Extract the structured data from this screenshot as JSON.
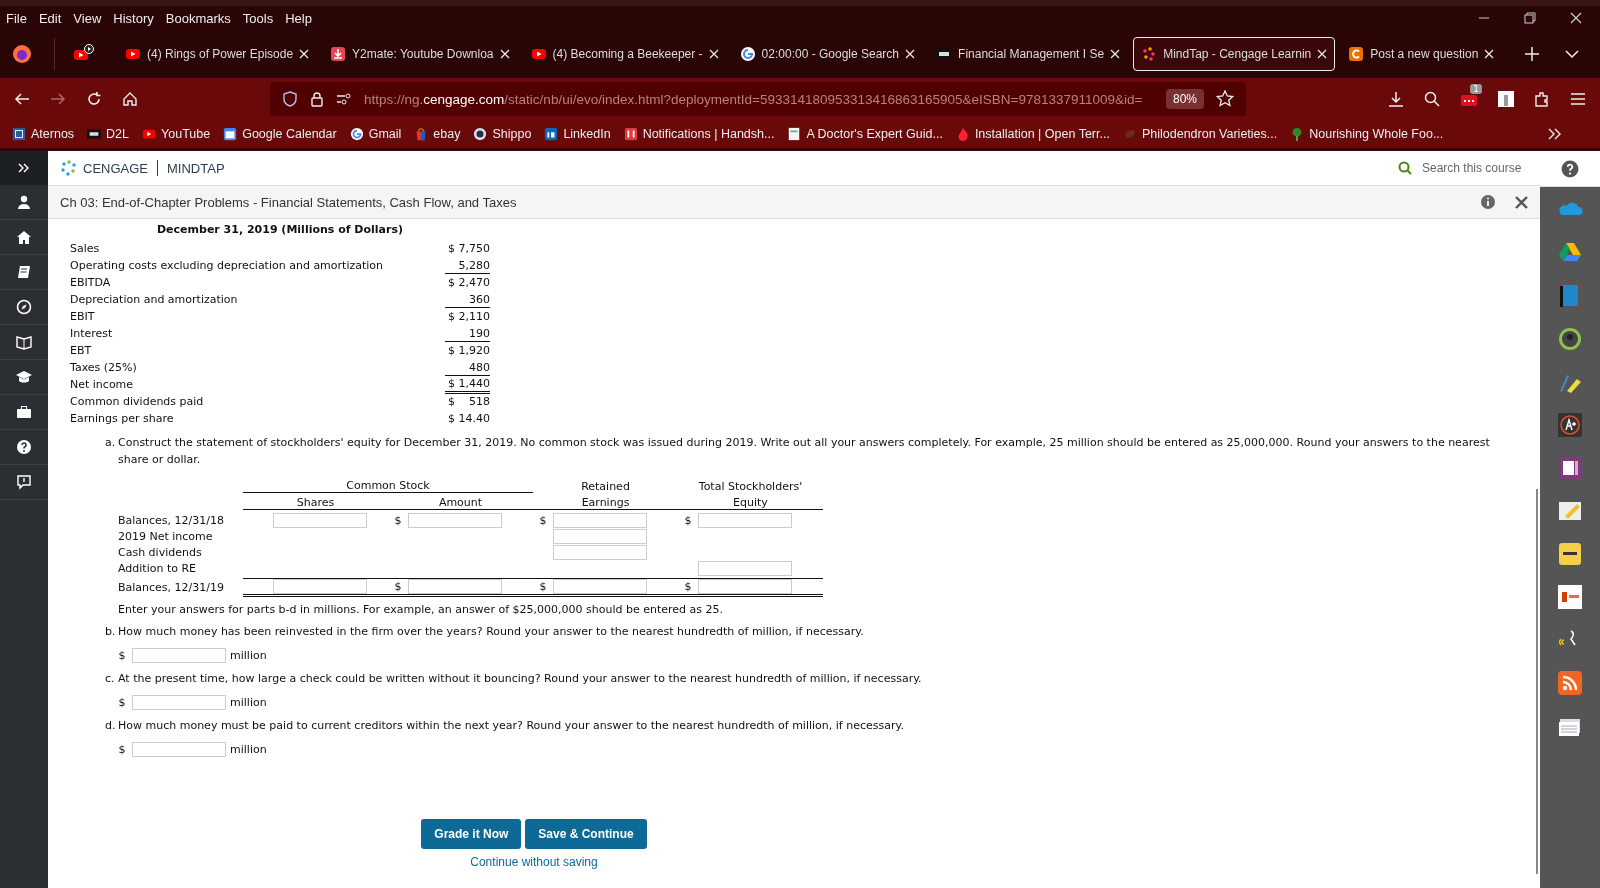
{
  "browser": {
    "menu": [
      "File",
      "Edit",
      "View",
      "History",
      "Bookmarks",
      "Tools",
      "Help"
    ],
    "tabs": [
      {
        "label": "(4) Rings of Power Episode",
        "kind": "youtube",
        "selected": false
      },
      {
        "label": "Y2mate: Youtube Downloa",
        "kind": "download",
        "selected": false
      },
      {
        "label": "(4) Becoming a Beekeeper -",
        "kind": "youtube",
        "selected": false
      },
      {
        "label": "02:00:00 - Google Search",
        "kind": "google",
        "selected": false
      },
      {
        "label": "Financial Management I Se",
        "kind": "d2l",
        "selected": false
      },
      {
        "label": "MindTap - Cengage Learnin",
        "kind": "mindtap",
        "selected": true
      },
      {
        "label": "Post a new question",
        "kind": "chegg",
        "selected": false
      }
    ],
    "url": {
      "prefix": "https://ng.",
      "host": "cengage.com",
      "rest": "/static/nb/ui/evo/index.html?deploymentId=593314180953313416863165905&eISBN=9781337911009&id="
    },
    "zoom": "80%",
    "extension_badge": "1",
    "bookmarks": [
      {
        "label": "Aternos",
        "kind": "grid"
      },
      {
        "label": "D2L",
        "kind": "d2l"
      },
      {
        "label": "YouTube",
        "kind": "youtube"
      },
      {
        "label": "Google Calendar",
        "kind": "calendar"
      },
      {
        "label": "Gmail",
        "kind": "google"
      },
      {
        "label": "ebay",
        "kind": "bag"
      },
      {
        "label": "Shippo",
        "kind": "globe"
      },
      {
        "label": "LinkedIn",
        "kind": "linkedin"
      },
      {
        "label": "Notifications | Handsh...",
        "kind": "handshake"
      },
      {
        "label": "A Doctor's Expert Guid...",
        "kind": "doc"
      },
      {
        "label": "Installation | Open Terr...",
        "kind": "flame"
      },
      {
        "label": "Philodendron Varieties...",
        "kind": "leaf"
      },
      {
        "label": "Nourishing Whole Foo...",
        "kind": "tree"
      }
    ]
  },
  "app": {
    "brand": "CENGAGE",
    "product": "MINDTAP",
    "search_placeholder": "Search this course",
    "title": "Ch 03: End-of-Chapter Problems - Financial Statements, Cash Flow, and Taxes"
  },
  "income_statement": {
    "title": "December 31, 2019 (Millions of Dollars)",
    "rows": [
      {
        "label": "Sales",
        "value": "$ 7,750",
        "underlined": false,
        "double_underlined": false
      },
      {
        "label": "Operating costs excluding depreciation and amortization",
        "value": "5,280",
        "underlined": true,
        "double_underlined": false
      },
      {
        "label": "EBITDA",
        "value": "$ 2,470",
        "underlined": false,
        "double_underlined": false
      },
      {
        "label": "Depreciation and amortization",
        "value": "360",
        "underlined": true,
        "double_underlined": false
      },
      {
        "label": "EBIT",
        "value": "$ 2,110",
        "underlined": false,
        "double_underlined": false
      },
      {
        "label": "Interest",
        "value": "190",
        "underlined": true,
        "double_underlined": false
      },
      {
        "label": "EBT",
        "value": "$ 1,920",
        "underlined": false,
        "double_underlined": false
      },
      {
        "label": "Taxes (25%)",
        "value": "480",
        "underlined": true,
        "double_underlined": false
      },
      {
        "label": "Net income",
        "value": "$ 1,440",
        "underlined": false,
        "double_underlined": true
      },
      {
        "label": "Common dividends paid",
        "value": "$    518",
        "underlined": false,
        "double_underlined": false
      },
      {
        "label": "Earnings per share",
        "value": "$ 14.40",
        "underlined": false,
        "double_underlined": false
      }
    ]
  },
  "part_a": {
    "marker": "a.",
    "text": "Construct the statement of stockholders' equity for December 31, 2019. No common stock was issued during 2019. Write out all your answers completely. For example, 25 million should be entered as 25,000,000. Round your answers to the nearest share or dollar.",
    "group_header": "Common Stock",
    "headers_top": [
      "Retained",
      "Total Stockholders'"
    ],
    "headers": [
      "Shares",
      "Amount",
      "Earnings",
      "Equity"
    ],
    "rows": [
      {
        "label": "Balances, 12/31/18",
        "total": false,
        "cells": [
          {
            "kind": "field"
          },
          {
            "kind": "field",
            "prefix": "$"
          },
          {
            "kind": "field",
            "prefix": "$"
          },
          {
            "kind": "field",
            "prefix": "$"
          }
        ]
      },
      {
        "label": "2019 Net income",
        "total": false,
        "cells": [
          {
            "kind": "blank"
          },
          {
            "kind": "blank"
          },
          {
            "kind": "field"
          },
          {
            "kind": "blank"
          }
        ]
      },
      {
        "label": "Cash dividends",
        "total": false,
        "cells": [
          {
            "kind": "blank"
          },
          {
            "kind": "blank"
          },
          {
            "kind": "field"
          },
          {
            "kind": "blank"
          }
        ]
      },
      {
        "label": "Addition to RE",
        "total": false,
        "cells": [
          {
            "kind": "blank"
          },
          {
            "kind": "blank"
          },
          {
            "kind": "blank"
          },
          {
            "kind": "field"
          }
        ]
      },
      {
        "label": "Balances, 12/31/19",
        "total": true,
        "cells": [
          {
            "kind": "field"
          },
          {
            "kind": "field",
            "prefix": "$"
          },
          {
            "kind": "field",
            "prefix": "$"
          },
          {
            "kind": "field",
            "prefix": "$"
          }
        ]
      }
    ],
    "note": "Enter your answers for parts b-d in millions. For example, an answer of $25,000,000 should be entered as 25."
  },
  "questions": [
    {
      "marker": "b.",
      "text": "How much money has been reinvested in the firm over the years? Round your answer to the nearest hundredth of million, if necessary.",
      "prefix": "$",
      "unit": "million"
    },
    {
      "marker": "c.",
      "text": "At the present time, how large a check could be written without it bouncing? Round your answer to the nearest hundredth of million, if necessary.",
      "prefix": "$",
      "unit": "million"
    },
    {
      "marker": "d.",
      "text": "How much money must be paid to current creditors within the next year? Round your answer to the nearest hundredth of million, if necessary.",
      "prefix": "$",
      "unit": "million"
    }
  ],
  "buttons": [
    "Grade it Now",
    "Save & Continue"
  ],
  "link": "Continue without saving"
}
